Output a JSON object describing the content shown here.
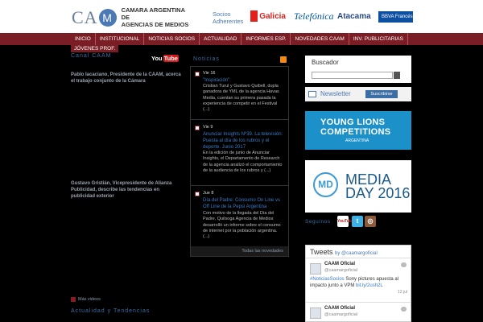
{
  "header": {
    "logo_mark": "CA",
    "logo_m": "M",
    "logo_line1": "CAMARA ARGENTINA DE",
    "logo_line2": "AGENCIAS DE MEDIOS",
    "socios_line1": "Socios",
    "socios_line2": "Adherentes",
    "sponsors": [
      "Galicia",
      "Telefónica",
      "Atacama",
      "BBVA Francés"
    ]
  },
  "nav": {
    "items": [
      "INICIO",
      "INSTITUCIONAL",
      "NOTICIAS SOCIOS",
      "ACTUALIDAD",
      "INFORMES ESP.",
      "NOVEDADES CAAM",
      "INV. PUBLICITARIAS"
    ],
    "row2": "JÓVENES PROF."
  },
  "left": {
    "canal_title": "Canal CAAM",
    "youtube_you": "You",
    "youtube_tube": "Tube",
    "video1_caption": "Pablo Iacaciano, Presidente de la CAAM, acerca el trabajo conjunto de la Cámara",
    "video2_caption": "Gustavo Gristián, Vicepresidente de Alianza Publicidad, describe las tendencias en publicidad exterior",
    "mas_videos": "Más videos",
    "actualidad_title": "Actualidad y Tendencias"
  },
  "noticias": {
    "title": "Noticias",
    "items": [
      {
        "date": "Vie 16",
        "title": "\"Inspiración\"",
        "body": "Cristian Turul y Gustavo Quibell, dupla ganadora de YML de la agencia Havas Media, cuentan su primera pasada la experiencia de competir en el Festival (...)"
      },
      {
        "date": "Vie 9",
        "title": "Anunciar Insights Nº39. La televisión: Puesta al día de los rubros y el deporte. Junio 2017",
        "body": "En la edición de junio de Anunciar Insights, el Departamento de Research de la agencia analizó el comportamiento de la audiencia de los rubros y (...)"
      },
      {
        "date": "Jue 8",
        "title": "Día del Padre: Consumo On Line vs Off Line de la Pepsi Argentina",
        "body": "Con motivo de la llegada del Día del Padre, Quilsoga Agencia de Medios desarrolló un informe sobre el consumo de internet por la población argentina. (...)"
      }
    ],
    "todas": "Todas las novedades"
  },
  "right": {
    "buscador_title": "Buscador",
    "search_value": "",
    "newsletter_label": "Newsletter",
    "suscribirse": "Suscribirse",
    "young_line1": "YOUNG LIONS",
    "young_line2": "COMPETITIONS",
    "young_line3": "ARGENTINA",
    "media_line1": "MEDIA",
    "media_line2": "DAY 2016",
    "media_mark": "MD",
    "siguenos": "Seguínos",
    "social": [
      "YouTube",
      "t",
      "◎"
    ]
  },
  "tweets": {
    "title": "Tweets",
    "by": "by @caamargoficial",
    "items": [
      {
        "name": "CAAM Oficial",
        "handle": "@caamargoficial",
        "text_tag": "#NoticiasSocios",
        "text": " Sony pictures apuesta al impacto junto a VPM ",
        "text_link": "bit.ly/2ush2L",
        "date": "12 jul"
      },
      {
        "name": "CAAM Oficial",
        "handle": "@caamargoficial"
      }
    ]
  },
  "colors": {
    "nav_bg": "#7a1d24",
    "accent_blue": "#3a6ea5",
    "young_lions": "#1b90c9"
  }
}
